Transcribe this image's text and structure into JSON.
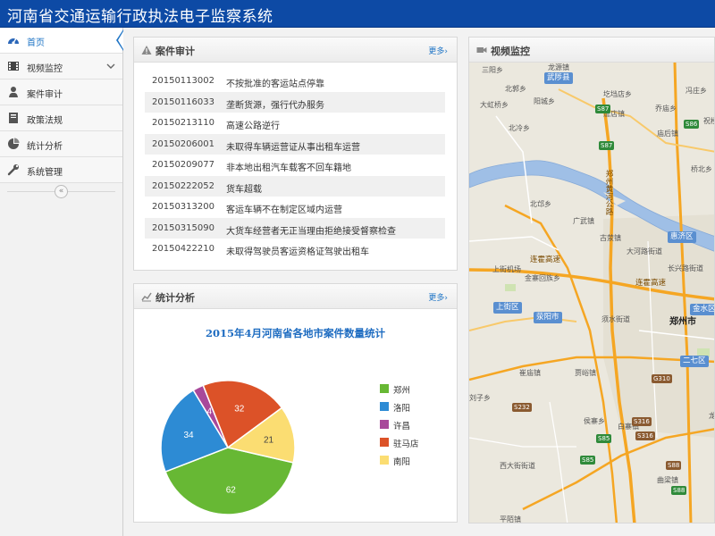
{
  "app": {
    "title": "河南省交通运输行政执法电子监察系统"
  },
  "sidebar": {
    "items": [
      {
        "label": "首页",
        "icon": "dashboard-icon"
      },
      {
        "label": "视频监控",
        "icon": "film-icon"
      },
      {
        "label": "案件审计",
        "icon": "user-icon"
      },
      {
        "label": "政策法规",
        "icon": "book-icon"
      },
      {
        "label": "统计分析",
        "icon": "pie-icon"
      },
      {
        "label": "系统管理",
        "icon": "wrench-icon"
      }
    ],
    "collapse_glyph": "«"
  },
  "cases_panel": {
    "title": "案件审计",
    "more": "更多›",
    "rows": [
      {
        "id": "20150113002",
        "desc": "不按批准的客运站点停靠"
      },
      {
        "id": "20150116033",
        "desc": "垄断货源，强行代办服务"
      },
      {
        "id": "20150213110",
        "desc": "高速公路逆行"
      },
      {
        "id": "20150206001",
        "desc": "未取得车辆运营证从事出租车运营"
      },
      {
        "id": "20150209077",
        "desc": "非本地出租汽车载客不回车籍地"
      },
      {
        "id": "20150222052",
        "desc": "货车超载"
      },
      {
        "id": "20150313200",
        "desc": "客运车辆不在制定区域内运营"
      },
      {
        "id": "20150315090",
        "desc": "大货车经营者无正当理由拒绝接受督察检查"
      },
      {
        "id": "20150422210",
        "desc": "未取得驾驶员客运资格证驾驶出租车"
      }
    ]
  },
  "stats_panel": {
    "title": "统计分析",
    "more": "更多›"
  },
  "chart_data": {
    "type": "pie",
    "title": "2015年4月河南省各地市案件数量统计",
    "legend_position": "right",
    "slices": [
      {
        "name": "郑州",
        "value": 62,
        "color": "#67b834"
      },
      {
        "name": "洛阳",
        "value": 34,
        "color": "#2d8bd4"
      },
      {
        "name": "许昌",
        "value": 4,
        "color": "#a8489a"
      },
      {
        "name": "驻马店",
        "value": 32,
        "color": "#dc5228"
      },
      {
        "name": "南阳",
        "value": 21,
        "color": "#fbdd72"
      }
    ]
  },
  "video_panel": {
    "title": "视频监控",
    "map": {
      "labels": [
        "三阳乡",
        "龙源镇",
        "武陟县",
        "北郭乡",
        "阳城乡",
        "圪垱店乡",
        "大虹桥乡",
        "詹店镇",
        "乔庙乡",
        "冯庄乡",
        "北冷乡",
        "庙后镇",
        "祝楼",
        "桥北乡",
        "北邙乡",
        "广武镇",
        "古荥镇",
        "惠济区",
        "上街机场",
        "金寨回族乡",
        "大河路街道",
        "上街区",
        "荥阳市",
        "长兴路街道",
        "金水区",
        "须水街道",
        "郑州市",
        "二七区",
        "崔庙镇",
        "贾峪镇",
        "刘子乡",
        "侯寨乡",
        "白寨镇",
        "龙",
        "西大街街道",
        "曲梁镇",
        "平陌镇"
      ],
      "roads": [
        "连霍高速",
        "连霍高速",
        "郑州黄河公路"
      ],
      "shields": [
        "S87",
        "S86",
        "S87",
        "G310",
        "S232",
        "S316",
        "S85",
        "S316",
        "S85",
        "S88",
        "S88"
      ]
    }
  }
}
